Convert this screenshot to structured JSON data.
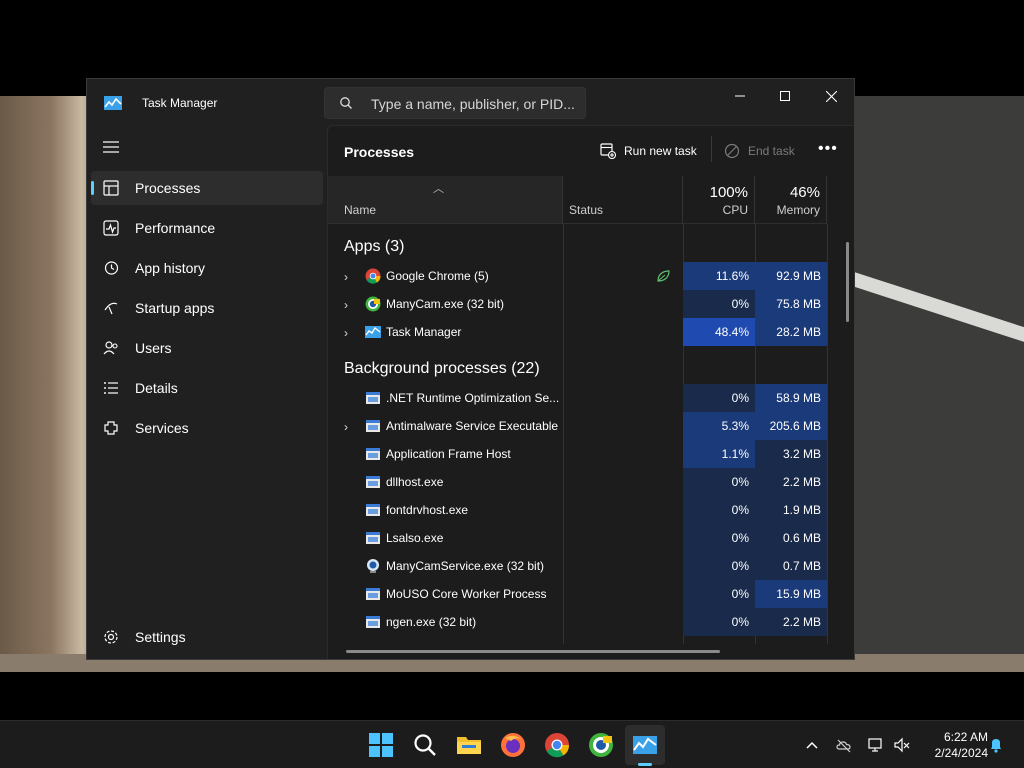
{
  "window": {
    "title": "Task Manager",
    "search_placeholder": "Type a name, publisher, or PID..."
  },
  "sidebar": {
    "items": [
      {
        "label": "Processes",
        "icon": "processes-icon",
        "active": true
      },
      {
        "label": "Performance",
        "icon": "performance-icon"
      },
      {
        "label": "App history",
        "icon": "history-icon"
      },
      {
        "label": "Startup apps",
        "icon": "startup-icon"
      },
      {
        "label": "Users",
        "icon": "users-icon"
      },
      {
        "label": "Details",
        "icon": "details-icon"
      },
      {
        "label": "Services",
        "icon": "services-icon"
      }
    ],
    "settings_label": "Settings"
  },
  "toolbar": {
    "page_title": "Processes",
    "run_new_task": "Run new task",
    "end_task": "End task"
  },
  "columns": {
    "name": "Name",
    "status": "Status",
    "cpu_label": "CPU",
    "cpu_total": "100%",
    "memory_label": "Memory",
    "memory_total": "46%"
  },
  "groups": {
    "apps": "Apps (3)",
    "background": "Background processes (22)"
  },
  "apps": [
    {
      "name": "Google Chrome (5)",
      "icon": "chrome-icon",
      "cpu": "11.6%",
      "mem": "92.9 MB",
      "expandable": true,
      "efficiency": true
    },
    {
      "name": "ManyCam.exe (32 bit)",
      "icon": "manycam-icon",
      "cpu": "0%",
      "mem": "75.8 MB",
      "expandable": true
    },
    {
      "name": "Task Manager",
      "icon": "taskmanager-icon",
      "cpu": "48.4%",
      "mem": "28.2 MB",
      "expandable": true
    }
  ],
  "background": [
    {
      "name": ".NET Runtime Optimization Se...",
      "icon": "process-icon",
      "cpu": "0%",
      "mem": "58.9 MB"
    },
    {
      "name": "Antimalware Service Executable",
      "icon": "process-icon",
      "cpu": "5.3%",
      "mem": "205.6 MB",
      "expandable": true
    },
    {
      "name": "Application Frame Host",
      "icon": "process-icon",
      "cpu": "1.1%",
      "mem": "3.2 MB"
    },
    {
      "name": "dllhost.exe",
      "icon": "process-icon",
      "cpu": "0%",
      "mem": "2.2 MB"
    },
    {
      "name": "fontdrvhost.exe",
      "icon": "process-icon",
      "cpu": "0%",
      "mem": "1.9 MB"
    },
    {
      "name": "Lsalso.exe",
      "icon": "process-icon",
      "cpu": "0%",
      "mem": "0.6 MB"
    },
    {
      "name": "ManyCamService.exe (32 bit)",
      "icon": "manycam-service-icon",
      "cpu": "0%",
      "mem": "0.7 MB"
    },
    {
      "name": "MoUSO Core Worker Process",
      "icon": "process-icon",
      "cpu": "0%",
      "mem": "15.9 MB"
    },
    {
      "name": "ngen.exe (32 bit)",
      "icon": "process-icon",
      "cpu": "0%",
      "mem": "2.2 MB"
    }
  ],
  "taskbar": {
    "time": "6:22 AM",
    "date": "2/24/2024"
  },
  "colors": {
    "accent": "#60cdff",
    "heat_low": "#1a2a4a",
    "heat_mid": "#1b3a7a",
    "heat_high": "#1f4bb0"
  }
}
